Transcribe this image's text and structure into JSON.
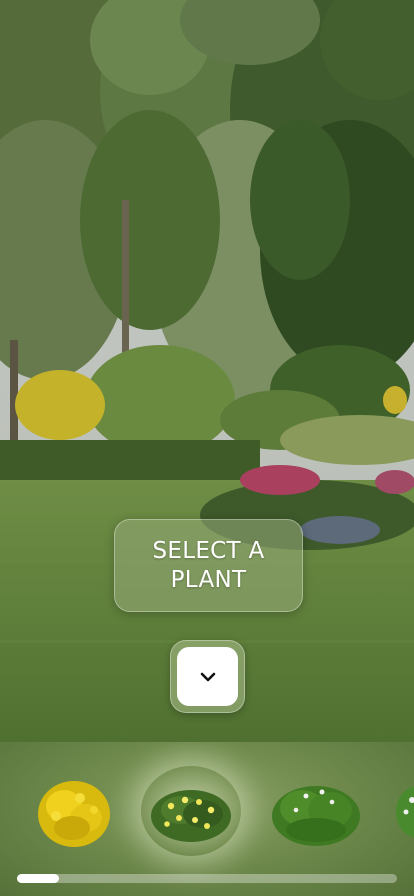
{
  "prompt": {
    "text": "SELECT A PLANT"
  },
  "toggle": {
    "icon": "chevron-down-icon"
  },
  "tray": {
    "plants": [
      {
        "icon": "yellow-shrub-icon",
        "selected": false
      },
      {
        "icon": "yellow-flower-shrub-icon",
        "selected": true
      },
      {
        "icon": "white-flower-shrub-icon",
        "selected": false
      },
      {
        "icon": "partial-shrub-icon",
        "selected": false
      }
    ],
    "scroll_position": 0.11
  },
  "colors": {
    "accent": "#ffffff",
    "tray_bg": "#6f8a4c",
    "grass": "#5e7d3a"
  }
}
